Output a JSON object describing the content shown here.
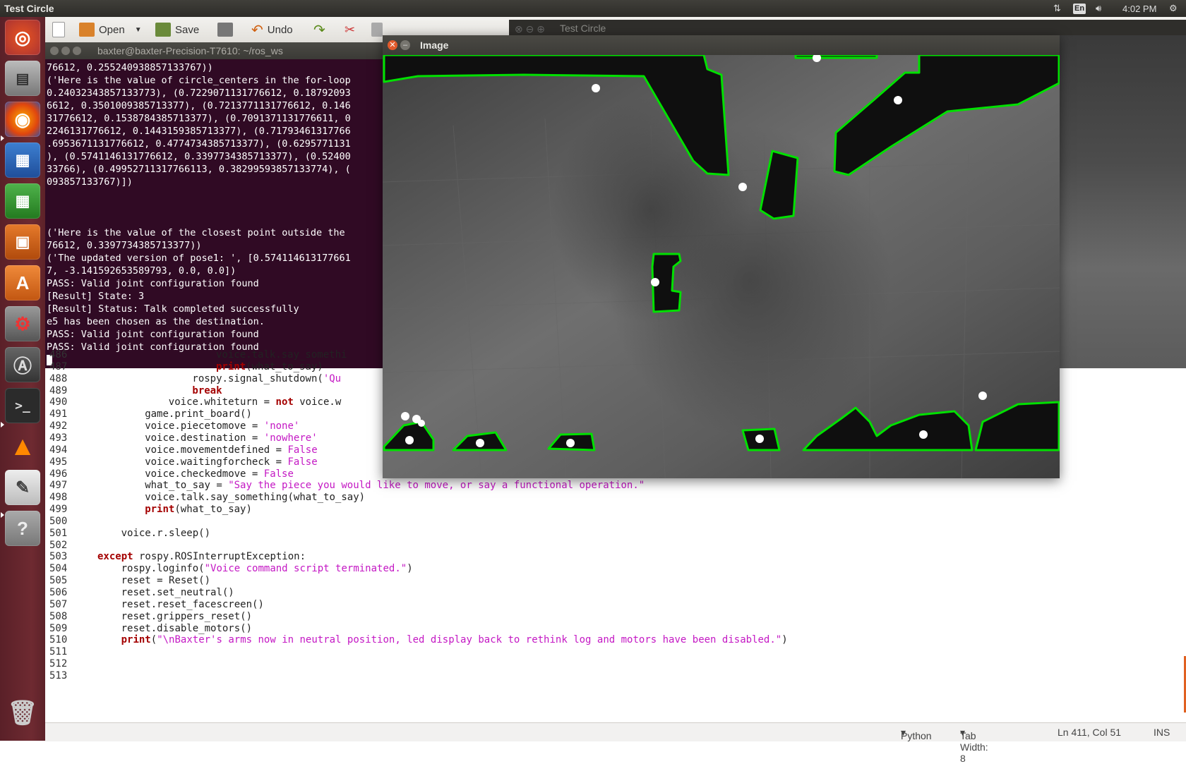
{
  "panel": {
    "window_title": "Test Circle",
    "lang": "En",
    "time": "4:02 PM"
  },
  "launcher": {
    "items": [
      "ubuntu-dash",
      "files",
      "firefox",
      "writer",
      "calc",
      "impress",
      "software-center",
      "system-settings",
      "software-updater",
      "terminal",
      "vlc",
      "text-editor",
      "help",
      "trash"
    ]
  },
  "toolbar": {
    "open_label": "Open",
    "save_label": "Save",
    "undo_label": "Undo"
  },
  "ghost_window_title": "Test Circle",
  "terminal": {
    "title": "baxter@baxter-Precision-T7610: ~/ros_ws",
    "lines": [
      "76612, 0.255240938857133767))",
      "('Here is the value of circle_centers in the for-loop",
      "0.24032343857133773), (0.7229071131776612, 0.18792093",
      "6612, 0.3501009385713377), (0.7213771131776612, 0.146",
      "31776612, 0.1538784385713377), (0.7091371131776611, 0",
      "2246131776612, 0.1443159385713377), (0.71793461317766",
      ".6953671131776612, 0.4774734385713377), (0.6295771131",
      "), (0.5741146131776612, 0.3397734385713377), (0.52400",
      "33766), (0.49952711317766113, 0.38299593857133774), (",
      "093857133767)])",
      "",
      "",
      "",
      "('Here is the value of the closest point outside the ",
      "76612, 0.3397734385713377))",
      "('The updated version of pose1: ', [0.574114613177661",
      "7, -3.141592653589793, 0.0, 0.0])",
      "PASS: Valid joint configuration found",
      "[Result] State: 3",
      "[Result] Status: Talk completed successfully",
      "e5 has been chosen as the destination.",
      "PASS: Valid joint configuration found",
      "PASS: Valid joint configuration found"
    ]
  },
  "code": {
    "lines": [
      {
        "n": "486",
        "indent": 20,
        "parts": [
          [
            "n",
            "voice.talk.say_somethi"
          ]
        ]
      },
      {
        "n": "487",
        "indent": 20,
        "parts": [
          [
            "k",
            "print"
          ],
          [
            "n",
            "(what_to_say)"
          ]
        ]
      },
      {
        "n": "488",
        "indent": 16,
        "parts": [
          [
            "n",
            "rospy.signal_shutdown("
          ],
          [
            "s",
            "'Qu"
          ]
        ]
      },
      {
        "n": "489",
        "indent": 16,
        "parts": [
          [
            "k",
            "break"
          ]
        ]
      },
      {
        "n": "490",
        "indent": 12,
        "parts": [
          [
            "n",
            "voice.whiteturn = "
          ],
          [
            "k",
            "not"
          ],
          [
            "n",
            " voice.w"
          ]
        ]
      },
      {
        "n": "491",
        "indent": 8,
        "parts": [
          [
            "n",
            "game.print_board()"
          ]
        ]
      },
      {
        "n": "492",
        "indent": 8,
        "parts": [
          [
            "n",
            "voice.piecetomove = "
          ],
          [
            "s",
            "'none'"
          ]
        ]
      },
      {
        "n": "493",
        "indent": 8,
        "parts": [
          [
            "n",
            "voice.destination = "
          ],
          [
            "s",
            "'nowhere'"
          ]
        ]
      },
      {
        "n": "494",
        "indent": 8,
        "parts": [
          [
            "n",
            "voice.movementdefined = "
          ],
          [
            "s",
            "False"
          ]
        ]
      },
      {
        "n": "495",
        "indent": 8,
        "parts": [
          [
            "n",
            "voice.waitingforcheck = "
          ],
          [
            "s",
            "False"
          ]
        ]
      },
      {
        "n": "496",
        "indent": 8,
        "parts": [
          [
            "n",
            "voice.checkedmove = "
          ],
          [
            "s",
            "False"
          ]
        ]
      },
      {
        "n": "497",
        "indent": 8,
        "parts": [
          [
            "n",
            "what_to_say = "
          ],
          [
            "s",
            "\"Say the piece you would like to move, or say a functional operation.\""
          ]
        ]
      },
      {
        "n": "498",
        "indent": 8,
        "parts": [
          [
            "n",
            "voice.talk.say_something(what_to_say)"
          ]
        ]
      },
      {
        "n": "499",
        "indent": 8,
        "parts": [
          [
            "k",
            "print"
          ],
          [
            "n",
            "(what_to_say)"
          ]
        ]
      },
      {
        "n": "500",
        "indent": 0,
        "parts": []
      },
      {
        "n": "501",
        "indent": 4,
        "parts": [
          [
            "n",
            "voice.r.sleep()"
          ]
        ]
      },
      {
        "n": "502",
        "indent": 0,
        "parts": []
      },
      {
        "n": "503",
        "indent": 0,
        "parts": [
          [
            "k",
            "except"
          ],
          [
            "n",
            " rospy.ROSInterruptException:"
          ]
        ]
      },
      {
        "n": "504",
        "indent": 4,
        "parts": [
          [
            "n",
            "rospy.loginfo("
          ],
          [
            "s",
            "\"Voice command script terminated.\""
          ],
          [
            "n",
            ")"
          ]
        ]
      },
      {
        "n": "505",
        "indent": 4,
        "parts": [
          [
            "n",
            "reset = Reset()"
          ]
        ]
      },
      {
        "n": "506",
        "indent": 4,
        "parts": [
          [
            "n",
            "reset.set_neutral()"
          ]
        ]
      },
      {
        "n": "507",
        "indent": 4,
        "parts": [
          [
            "n",
            "reset.reset_facescreen()"
          ]
        ]
      },
      {
        "n": "508",
        "indent": 4,
        "parts": [
          [
            "n",
            "reset.grippers_reset()"
          ]
        ]
      },
      {
        "n": "509",
        "indent": 4,
        "parts": [
          [
            "n",
            "reset.disable_motors()"
          ]
        ]
      },
      {
        "n": "510",
        "indent": 4,
        "parts": [
          [
            "k",
            "print"
          ],
          [
            "n",
            "("
          ],
          [
            "s",
            "\"\\nBaxter's arms now in neutral position, led display back to rethink log and motors have been disabled.\""
          ],
          [
            "n",
            ")"
          ]
        ]
      },
      {
        "n": "511",
        "indent": 0,
        "parts": []
      },
      {
        "n": "512",
        "indent": 0,
        "parts": []
      },
      {
        "n": "513",
        "indent": 0,
        "parts": []
      }
    ]
  },
  "statusbar": {
    "language": "Python",
    "tab_width": "Tab Width: 8",
    "position": "Ln 411, Col 51",
    "mode": "INS"
  },
  "image_window": {
    "title": "Image"
  },
  "colors": {
    "contour": "#00e000",
    "terminal_bg": "#300a24",
    "launcher": "#6e2a31"
  }
}
